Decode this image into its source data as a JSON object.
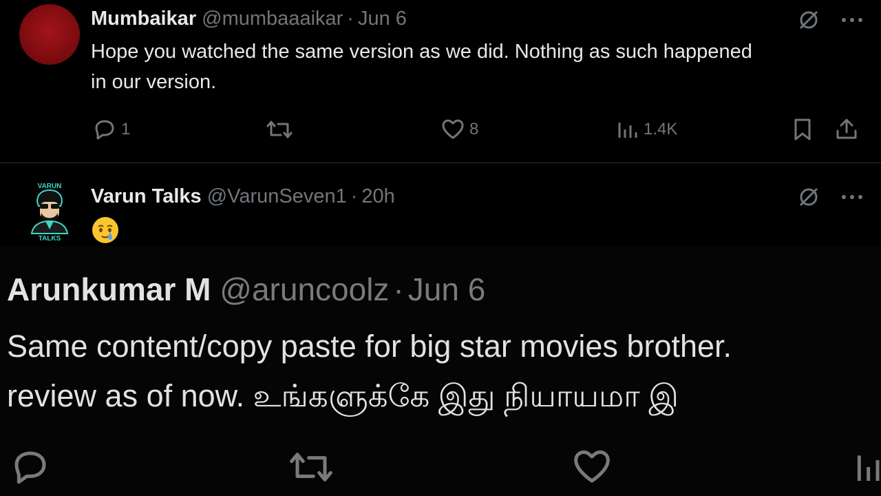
{
  "tweets": [
    {
      "author": "Mumbaikar",
      "handle": "@mumbaaaikar",
      "separator": "·",
      "time": "Jun 6",
      "text_line1": "Hope you watched the same version as we did. Nothing as such happened",
      "text_line2": "in our version.",
      "replies": "1",
      "likes": "8",
      "views": "1.4K",
      "icons": [
        "grok-slash-icon",
        "more-icon",
        "reply-icon",
        "retweet-icon",
        "like-icon",
        "views-icon",
        "bookmark-icon",
        "share-icon"
      ]
    },
    {
      "author": "Varun Talks",
      "handle": "@VarunSeven1",
      "separator": "·",
      "time": "20h",
      "avatar_top_text": "VARUN",
      "avatar_bottom_text": "TALKS",
      "emoji_name": "face-holding-back-tears",
      "icons": [
        "grok-slash-icon",
        "more-icon"
      ]
    }
  ],
  "embedded_tweet": {
    "author": "Arunkumar M",
    "handle": "@aruncoolz",
    "separator": "·",
    "time": "Jun 6",
    "text_line1": "Same content/copy paste for big star movies brother.",
    "text_line2": "review as of now. உங்களுக்கே இது நியாயமா இ",
    "icons": [
      "reply-icon",
      "retweet-icon",
      "like-icon",
      "views-icon"
    ]
  },
  "colors": {
    "background": "#000000",
    "text_primary": "#e7e9ea",
    "text_secondary": "#71767b",
    "divider": "#2f3336",
    "avatar_red": "#8c0f13",
    "avatar_teal": "#3fd6c6"
  }
}
